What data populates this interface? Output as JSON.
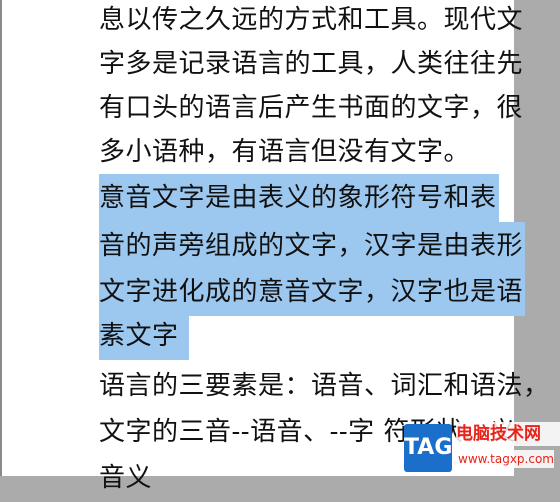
{
  "document": {
    "lines": [
      "息以传之久远的方式和工具。现代文",
      "字多是记录语言的工具，人类往往先",
      "有口头的语言后产生书面的文字，很",
      "多小语种，有语言但没有文字。",
      "意音文字是由表义的象形符号和表",
      "音的声旁组成的文字，汉字是由表形",
      "文字进化成的意音文字，汉字也是语",
      "素文字",
      "语言的三要素是：语音、词汇和语法，",
      "文字的三音--语音、--字 符形状、义",
      "音义"
    ]
  },
  "watermark": {
    "tag": "TAG",
    "title": "电脑技术网",
    "url": "www.tagxp.com"
  },
  "colors": {
    "selection": "#9cc8ef",
    "background": "#ababab",
    "page": "#ffffff",
    "watermark_blue": "#1b6fcb",
    "watermark_red": "#e8231a"
  }
}
